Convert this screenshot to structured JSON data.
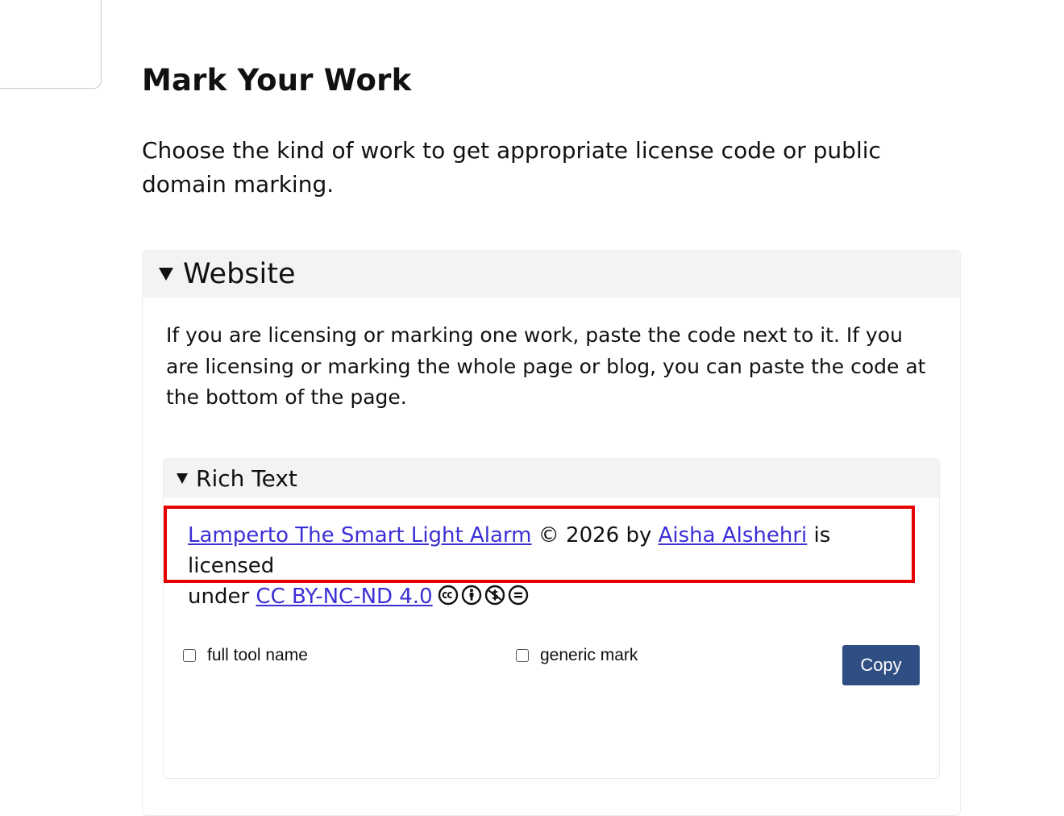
{
  "page": {
    "title": "Mark Your Work",
    "intro": "Choose the kind of work to get appropriate license code or public domain marking."
  },
  "website": {
    "label": "Website",
    "description": "If you are licensing or marking one work, paste the code next to it. If you are licensing or marking the whole page or blog, you can paste the code at the bottom of the page.",
    "rich_text": {
      "label": "Rich Text",
      "attribution": {
        "work_title": "Lamperto The Smart Light Alarm",
        "copyright": "© 2026 by",
        "author": "Aisha Alshehri",
        "licensed_under_1": "is licensed",
        "licensed_under_2": "under",
        "license": "CC BY-NC-ND 4.0",
        "icons": [
          "cc-icon",
          "by-icon",
          "nc-icon",
          "nd-icon"
        ]
      },
      "options": {
        "full_tool_name": "full tool name",
        "generic_mark": "generic mark"
      },
      "copy_label": "Copy"
    }
  },
  "colors": {
    "link": "#3b2fd6",
    "highlight_border": "#e60000",
    "copy_button": "#2f4e83",
    "summary_bg": "#f3f3f3"
  }
}
